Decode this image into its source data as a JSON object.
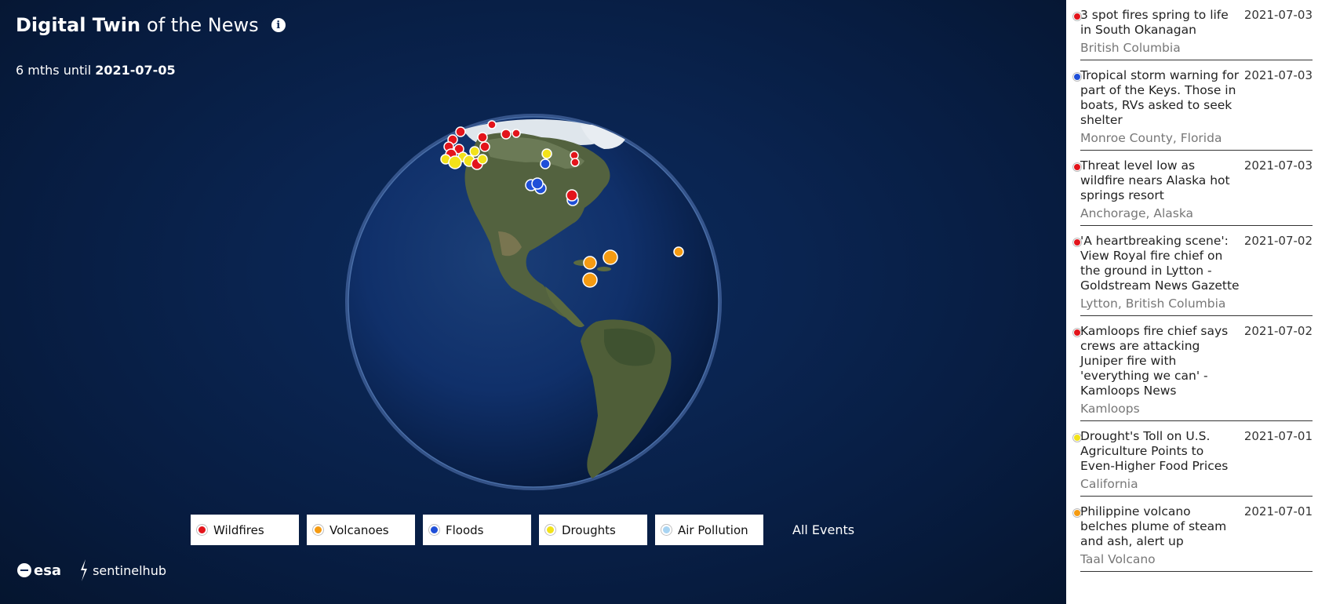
{
  "header": {
    "title_bold": "Digital Twin",
    "title_light": "of the News",
    "info_icon": "info-icon"
  },
  "period": {
    "prefix": "6 mths until",
    "date": "2021-07-05"
  },
  "globe": {
    "ocean_color": "#0b2a5a",
    "land_color": "#4a5a3a"
  },
  "legend": {
    "items": [
      {
        "label": "Wildfires",
        "color": "#e3141b"
      },
      {
        "label": "Volcanoes",
        "color": "#f59b12"
      },
      {
        "label": "Floods",
        "color": "#1f4fd8"
      },
      {
        "label": "Droughts",
        "color": "#f2e21a"
      },
      {
        "label": "Air Pollution",
        "color": "#a8d4f2"
      }
    ],
    "all_events": "All Events"
  },
  "logos": {
    "esa": "esa",
    "sentinelhub": "sentinelhub"
  },
  "news": [
    {
      "title": "3 spot fires spring to life in South Okanagan",
      "date": "2021-07-03",
      "location": "British Columbia",
      "color": "#e3141b"
    },
    {
      "title": "Tropical storm warning for part of the Keys. Those in boats, RVs asked to seek shelter",
      "date": "2021-07-03",
      "location": "Monroe County, Florida",
      "color": "#1f4fd8"
    },
    {
      "title": "Threat level low as wildfire nears Alaska hot springs resort",
      "date": "2021-07-03",
      "location": "Anchorage, Alaska",
      "color": "#e3141b"
    },
    {
      "title": "'A heartbreaking scene': View Royal fire chief on the ground in Lytton - Goldstream News Gazette",
      "date": "2021-07-02",
      "location": "Lytton, British Columbia",
      "color": "#e3141b"
    },
    {
      "title": "Kamloops fire chief says crews are attacking Juniper fire with 'everything we can' - Kamloops News",
      "date": "2021-07-02",
      "location": "Kamloops",
      "color": "#e3141b"
    },
    {
      "title": "Drought's Toll on U.S. Agriculture Points to Even-Higher Food Prices",
      "date": "2021-07-01",
      "location": "California",
      "color": "#f2e21a"
    },
    {
      "title": "Philippine volcano belches plume of steam and ash, alert up",
      "date": "2021-07-01",
      "location": "Taal Volcano",
      "color": "#f59b12"
    }
  ]
}
